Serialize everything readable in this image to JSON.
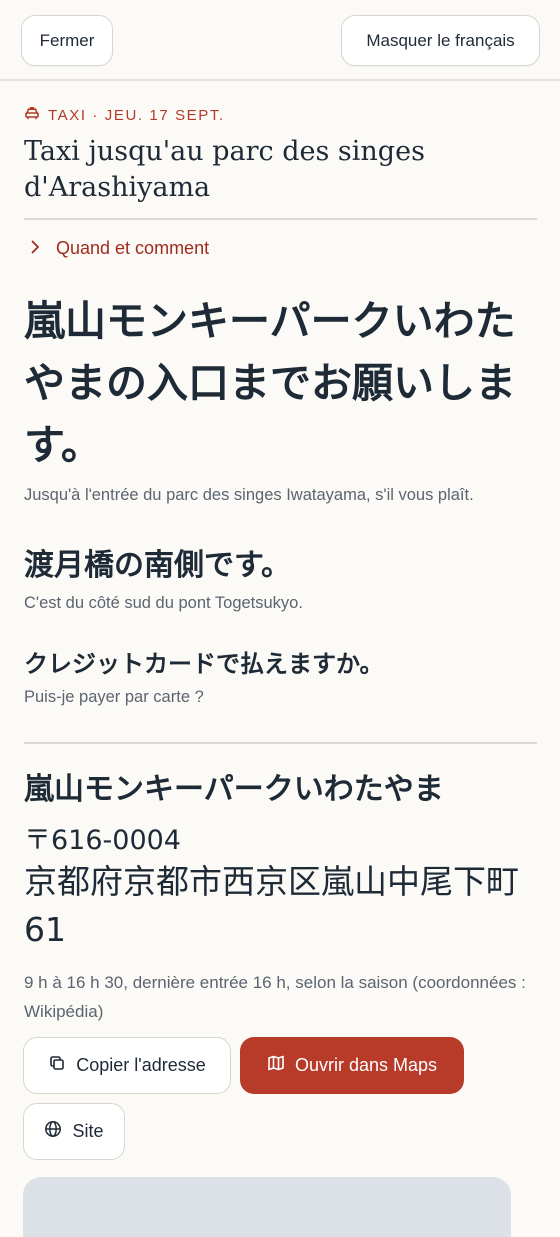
{
  "topbar": {
    "close_label": "Fermer",
    "toggle_french_label": "Masquer le français"
  },
  "card": {
    "kicker": "TAXI · JEU. 17 SEPT.",
    "kicker_icon": "taxi-icon",
    "title": "Taxi jusqu'au parc des singes d'Arashiyama",
    "disclosure_label": "Quand et comment",
    "disclosure_icon": "chevron-right-icon"
  },
  "phrases": [
    {
      "ja": "嵐山モンキーパークいわたやまの入口までお願いします。",
      "fr": "Jusqu'à l'entrée du parc des singes Iwatayama, s'il vous plaît."
    },
    {
      "ja": "渡月橋の南側です。",
      "fr": "C'est du côté sud du pont Togetsukyo."
    },
    {
      "ja": "クレジットカードで払えますか。",
      "fr": "Puis-je payer par carte ?"
    }
  ],
  "destination": {
    "name": "嵐山モンキーパークいわたやま",
    "postal": "〒616-0004",
    "address": "京都府京都市西京区嵐山中尾下町61",
    "hours": "9 h à 16 h 30, dernière entrée 16 h, selon la saison (coordonnées : Wikipédia)"
  },
  "actions": {
    "copy_label": "Copier l'adresse",
    "copy_icon": "copy-icon",
    "maps_label": "Ouvrir dans Maps",
    "maps_icon": "map-icon",
    "site_label": "Site",
    "site_icon": "globe-icon"
  },
  "colors": {
    "accent": "#B83A28",
    "background": "#FBFAF6",
    "text": "#1F2A37",
    "muted": "#5B6470"
  }
}
